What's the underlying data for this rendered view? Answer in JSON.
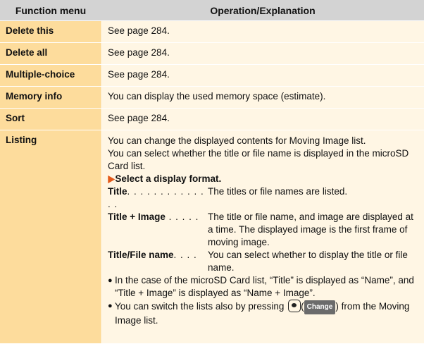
{
  "header": {
    "col1": "Function menu",
    "col2": "Operation/Explanation"
  },
  "rows": [
    {
      "label": "Delete this",
      "text": "See page 284."
    },
    {
      "label": "Delete all",
      "text": "See page 284."
    },
    {
      "label": "Multiple-choice",
      "text": "See page 284."
    },
    {
      "label": "Memory info",
      "text": "You can display the used memory space (estimate)."
    },
    {
      "label": "Sort",
      "text": "See page 284."
    }
  ],
  "listing": {
    "label": "Listing",
    "intro1": "You can change the displayed contents for Moving Image list.",
    "intro2": "You can select whether the title or file name is displayed in the microSD Card list.",
    "step": "Select a display format.",
    "step_marker": "▶",
    "options": [
      {
        "term": "Title",
        "dots": ". . . . . . . . . . . . . .",
        "desc": "The titles or file names are listed."
      },
      {
        "term": "Title + Image",
        "dots": " . . . . .",
        "desc": "The title or file name, and image are displayed at a time. The displayed image is the first frame of moving image."
      },
      {
        "term": "Title/File name",
        "dots": ". . . .",
        "desc": "You can select whether to display the title or file name."
      }
    ],
    "bullets": [
      {
        "text": "In the case of the microSD Card list, “Title” is displayed as “Name”, and “Title + Image” is displayed as “Name + Image”."
      }
    ],
    "bullet2_pre": "You can switch the lists also by pressing",
    "bullet2_key_label": "Change",
    "bullet2_post": "from the Moving Image list.",
    "bullet_marker": "●",
    "key_icon": "camera-key-icon"
  }
}
